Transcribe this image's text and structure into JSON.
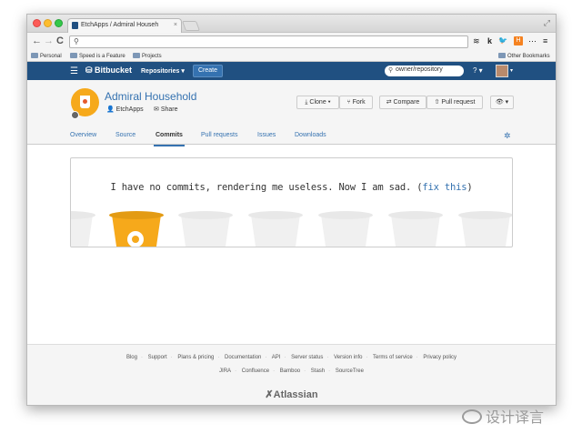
{
  "browser": {
    "tab_title": "EtchApps / Admiral Househ",
    "url": "",
    "bookmarks": [
      "Personal",
      "Speed is a Feature",
      "Projects"
    ],
    "other_bookmarks": "Other Bookmarks",
    "extensions": [
      "≋",
      "k",
      "🐦",
      "H",
      "⋯",
      "≡"
    ]
  },
  "header": {
    "logo": "Bitbucket",
    "repositories_menu": "Repositories ▾",
    "create_label": "Create",
    "search_placeholder": "owner/repository",
    "help": "? ▾"
  },
  "repo": {
    "name": "Admiral Household",
    "owner": "EtchApps",
    "share": "Share",
    "actions": {
      "clone": "Clone ▾",
      "fork": "Fork",
      "compare": "Compare",
      "pull_request": "Pull request",
      "watch": "👁 ▾"
    }
  },
  "tabs": [
    "Overview",
    "Source",
    "Commits",
    "Pull requests",
    "Issues",
    "Downloads"
  ],
  "active_tab": "Commits",
  "empty_state": {
    "message": "I have no commits, rendering me useless. Now I am sad. (",
    "link": "fix this",
    "close": ")"
  },
  "footer": {
    "row1": [
      "Blog",
      "Support",
      "Plans & pricing",
      "Documentation",
      "API",
      "Server status",
      "Version info",
      "Terms of service",
      "Privacy policy"
    ],
    "row2": [
      "JIRA",
      "Confluence",
      "Bamboo",
      "Stash",
      "SourceTree"
    ],
    "brand": "Atlassian"
  },
  "watermark": "设计译言",
  "colors": {
    "brand_blue": "#205081",
    "link_blue": "#3572b0",
    "bucket_orange": "#f6a91b"
  }
}
